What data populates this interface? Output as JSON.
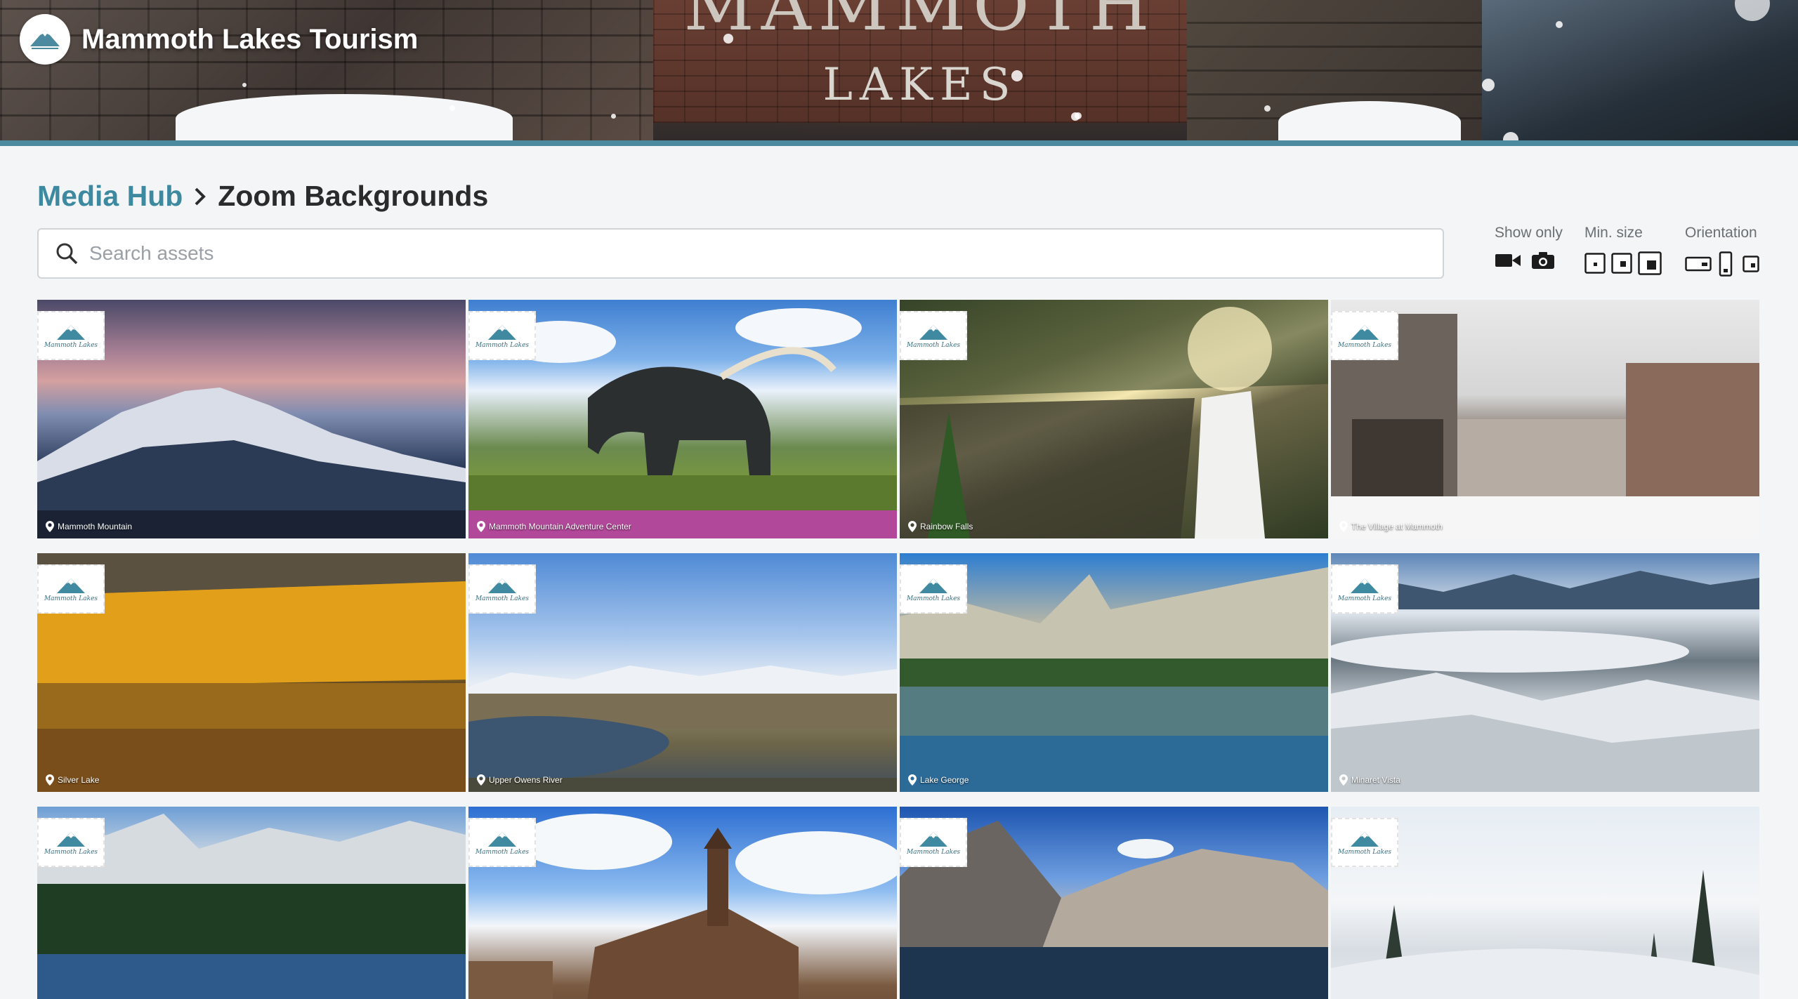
{
  "header": {
    "brand_title": "Mammoth Lakes Tourism",
    "sign_top": "MAMMOTH",
    "sign_bottom": "LAKES",
    "colors": {
      "accent": "#4c8aa0",
      "link": "#3d8aa0"
    }
  },
  "breadcrumb": {
    "root": "Media Hub",
    "current": "Zoom Backgrounds"
  },
  "search": {
    "placeholder": "Search assets",
    "value": ""
  },
  "filters": {
    "show_only": {
      "label": "Show only",
      "options": [
        "video-camera-icon",
        "photo-camera-icon"
      ]
    },
    "min_size": {
      "label": "Min. size",
      "options": [
        "size-small-icon",
        "size-medium-icon",
        "size-large-icon"
      ]
    },
    "orientation": {
      "label": "Orientation",
      "options": [
        "landscape-icon",
        "portrait-icon",
        "square-icon"
      ]
    }
  },
  "assets": [
    {
      "location": "Mammoth Mountain",
      "stamp": "Mammoth Lakes"
    },
    {
      "location": "Mammoth Mountain Adventure Center",
      "stamp": "Mammoth Lakes"
    },
    {
      "location": "Rainbow Falls",
      "stamp": "Mammoth Lakes"
    },
    {
      "location": "The Village at Mammoth",
      "stamp": "Mammoth Lakes"
    },
    {
      "location": "Silver Lake",
      "stamp": "Mammoth Lakes"
    },
    {
      "location": "Upper Owens River",
      "stamp": "Mammoth Lakes"
    },
    {
      "location": "Lake George",
      "stamp": "Mammoth Lakes"
    },
    {
      "location": "Minaret Vista",
      "stamp": "Mammoth Lakes"
    },
    {
      "location": "",
      "stamp": "Mammoth Lakes"
    },
    {
      "location": "",
      "stamp": "Mammoth Lakes"
    },
    {
      "location": "",
      "stamp": "Mammoth Lakes"
    },
    {
      "location": "",
      "stamp": "Mammoth Lakes"
    }
  ]
}
